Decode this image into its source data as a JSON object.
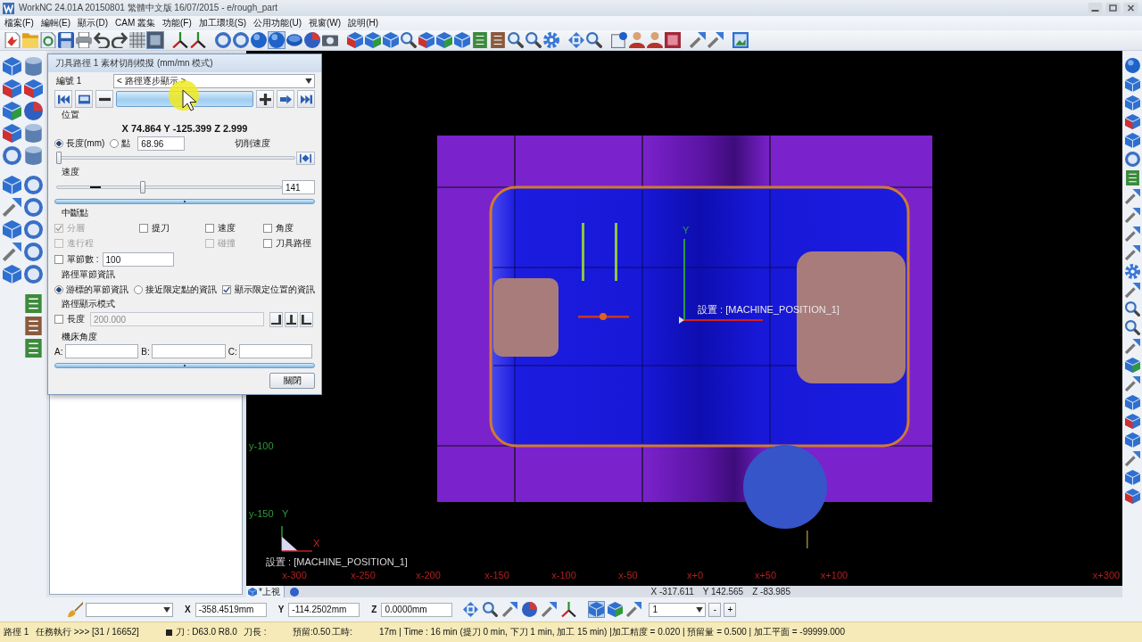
{
  "window": {
    "title": "WorkNC 24.01A  20150801  繁體中文版  16/07/2015 - e/rough_part"
  },
  "menu": [
    "檔案(F)",
    "編輯(E)",
    "顯示(D)",
    "CAM 叢集",
    "功能(F)",
    "加工環境(S)",
    "公用功能(U)",
    "視窗(W)",
    "說明(H)"
  ],
  "toolbar": {
    "buttons": [
      {
        "selected": false
      },
      {
        "selected": false
      },
      {
        "selected": false
      },
      {
        "selected": false
      },
      {
        "selected": false
      },
      {
        "selected": false
      },
      {
        "selected": false
      },
      {
        "selected": false
      },
      {
        "selected": true
      },
      {
        "selected": false
      },
      {
        "selected": false
      },
      {
        "selected": false
      },
      {
        "selected": false
      },
      {
        "selected": false
      },
      {
        "selected": true
      },
      {
        "selected": false
      },
      {
        "selected": false
      },
      {
        "selected": false
      },
      {
        "selected": false
      },
      {
        "selected": false
      },
      {
        "selected": false
      },
      {
        "selected": false
      },
      {
        "selected": false
      },
      {
        "selected": false
      },
      {
        "selected": false
      },
      {
        "selected": false
      },
      {
        "selected": false
      },
      {
        "selected": false
      },
      {
        "selected": false
      },
      {
        "selected": false
      },
      {
        "selected": false
      },
      {
        "selected": false
      },
      {
        "selected": false
      },
      {
        "selected": false
      },
      {
        "selected": false
      },
      {
        "selected": false
      },
      {
        "selected": false
      },
      {
        "selected": false
      },
      {
        "selected": false
      }
    ]
  },
  "dialog": {
    "title": "刀具路徑 1 素材切削模擬 (mm/mn 模式)",
    "number_label": "編號 1",
    "path_dropdown": "< 路徑逐步顯示 >",
    "position_label": "位置",
    "position": "X 74.864 Y -125.399 Z 2.999",
    "step_modes": [
      {
        "label": "長度(mm)",
        "selected": true
      },
      {
        "label": "點",
        "selected": false
      }
    ],
    "step_value": "68.96",
    "feed_label": "切削速度",
    "progress_slider": {
      "level": 0.0
    },
    "speed_label": "速度",
    "speed_slider": {
      "level": 0.38
    },
    "speed_value": "141",
    "breakpoints_label": "中斷點",
    "breakpoints": [
      {
        "label": "分層",
        "checked": true,
        "disabled": true
      },
      {
        "label": "提刀",
        "checked": false,
        "disabled": false
      },
      {
        "label": "速度",
        "checked": false,
        "disabled": false
      },
      {
        "label": "角度",
        "checked": false,
        "disabled": false
      },
      {
        "label": "進行程",
        "checked": false,
        "disabled": true
      },
      {
        "label": "碰撞",
        "checked": false,
        "disabled": true
      },
      {
        "label": "刀具路徑",
        "checked": false,
        "disabled": false
      }
    ],
    "block_count": {
      "label": "單節數 :",
      "checked": false,
      "value": "100"
    },
    "block_info_label": "路徑單節資訊",
    "block_info_modes": [
      {
        "label": "游標的單節資訊",
        "selected": true
      },
      {
        "label": "接近限定點的資訊",
        "selected": false
      }
    ],
    "show_limit_info": {
      "label": "顯示限定位置的資訊",
      "checked": true
    },
    "display_mode_label": "路徑顯示模式",
    "length": {
      "label": "長度",
      "checked": false,
      "value": "200.000",
      "disabled": true
    },
    "machine_angle_label": "機床角度",
    "angles": [
      "A:",
      "B:",
      "C:"
    ],
    "close_button": "關閉"
  },
  "viewport": {
    "axis_label": "Y",
    "setup_label": "設置 : [MACHINE_POSITION_1]",
    "y_ticks": [
      "y-100",
      "y-150"
    ],
    "triad": {
      "y": "Y",
      "x": "X"
    },
    "setup_label_2": "設置 : [MACHINE_POSITION_1]",
    "x_ticks": [
      "x-300",
      "x-250",
      "x-200",
      "x-150",
      "x-100",
      "x-50",
      "x+0",
      "x+50",
      "x+100",
      "x+300"
    ],
    "view_tab": "*上視",
    "coordinates": [
      "X -317.611",
      "Y 142.565",
      "Z -83.985"
    ]
  },
  "coordinate_bar": {
    "fields": [
      {
        "label": "X",
        "value": "-358.4519mm"
      },
      {
        "label": "Y",
        "value": "-114.2502mm"
      },
      {
        "label": "Z",
        "value": "0.0000mm"
      }
    ],
    "view_buttons": [
      {
        "selected": true
      },
      {
        "selected": false
      },
      {
        "selected": false
      }
    ],
    "count": "1",
    "step_buttons": [
      "-",
      "+"
    ]
  },
  "status_bar": {
    "segments": [
      {
        "kind": "text",
        "text": "路徑 1"
      },
      {
        "kind": "text",
        "text": "任務執行 >>> [31 / 16652]"
      },
      {
        "kind": "icon"
      },
      {
        "kind": "text",
        "text": "刀 : D63.0 R8.0"
      },
      {
        "kind": "text",
        "text": "刀長 :"
      },
      {
        "kind": "text",
        "text": "預留:0.50"
      },
      {
        "kind": "text",
        "text": "工時:"
      },
      {
        "kind": "text",
        "text": "17m | Time : 16 min (提刀 0 min, 下刀 1 min, 加工 15 min) |加工精度 = 0.020 | 預留量 = 0.500 | 加工平面 = -99999.000"
      }
    ]
  }
}
